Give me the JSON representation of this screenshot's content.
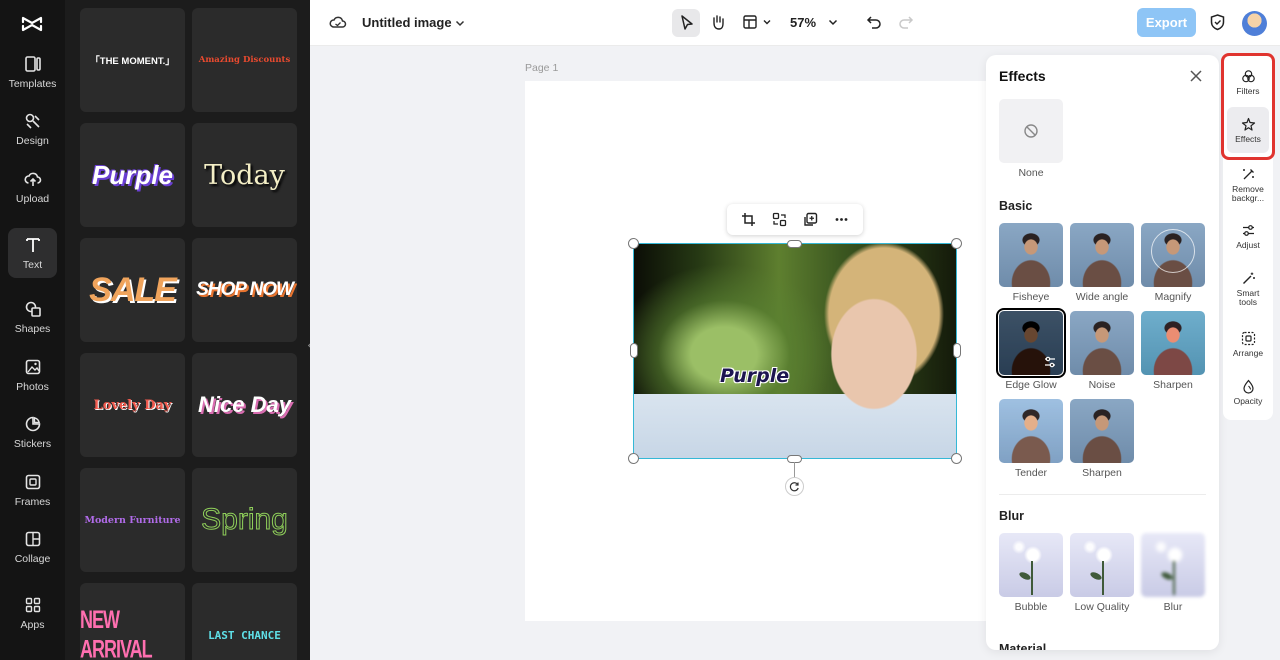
{
  "leftnav": {
    "items": [
      {
        "label": "Templates"
      },
      {
        "label": "Design"
      },
      {
        "label": "Upload"
      },
      {
        "label": "Text"
      },
      {
        "label": "Shapes"
      },
      {
        "label": "Photos"
      },
      {
        "label": "Stickers"
      },
      {
        "label": "Frames"
      },
      {
        "label": "Collage"
      },
      {
        "label": "Apps"
      }
    ],
    "active": "Text"
  },
  "text_templates": [
    {
      "text": "「THE MOMENT.」"
    },
    {
      "text": "Amazing Discounts"
    },
    {
      "text": "Purple"
    },
    {
      "text": "Today"
    },
    {
      "text": "SALE"
    },
    {
      "text": "SHOP NOW"
    },
    {
      "text": "Lovely Day"
    },
    {
      "text": "Nice Day"
    },
    {
      "text": "Modern Furniture"
    },
    {
      "text": "Spring"
    },
    {
      "text": "NEW ARRIVAL"
    },
    {
      "text": "LAST CHANCE"
    }
  ],
  "topbar": {
    "title": "Untitled image",
    "zoom": "57%",
    "export_label": "Export"
  },
  "canvas": {
    "page_label": "Page 1",
    "photo_text": "Purple"
  },
  "effects_panel": {
    "title": "Effects",
    "none_label": "None",
    "sections": {
      "basic": {
        "title": "Basic",
        "items": [
          "Fisheye",
          "Wide angle",
          "Magnify",
          "Edge Glow",
          "Noise",
          "Sharpen",
          "Tender",
          "Sharpen"
        ],
        "selected": "Edge Glow"
      },
      "blur": {
        "title": "Blur",
        "items": [
          "Bubble",
          "Low Quality",
          "Blur"
        ]
      },
      "material": {
        "title": "Material"
      }
    }
  },
  "right_rail": {
    "items": [
      {
        "label": "Filters"
      },
      {
        "label": "Effects"
      },
      {
        "label": "Remove backgr..."
      },
      {
        "label": "Adjust"
      },
      {
        "label": "Smart tools"
      },
      {
        "label": "Arrange"
      },
      {
        "label": "Opacity"
      }
    ],
    "active": "Effects",
    "highlight_color": "#e0342f"
  },
  "colors": {
    "accent": "#35b8d6",
    "export_bg": "#8ec5f6"
  }
}
